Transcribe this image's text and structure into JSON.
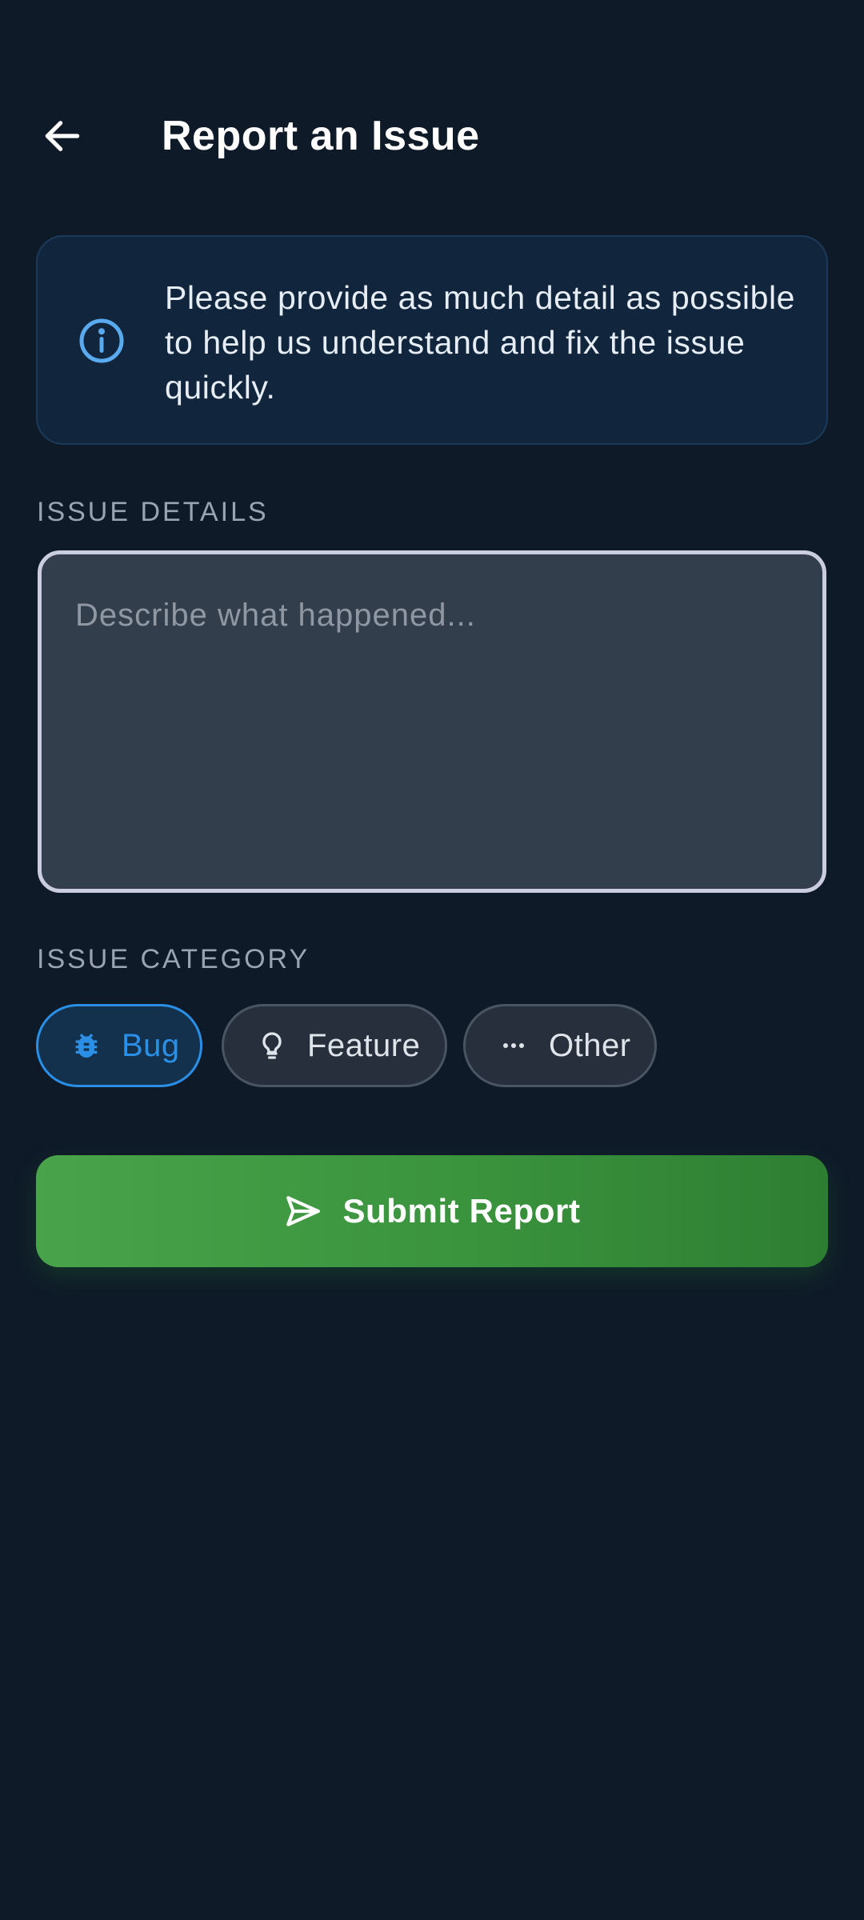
{
  "header": {
    "title": "Report an Issue",
    "back_icon": "arrow-left-icon"
  },
  "info_card": {
    "icon": "info-icon",
    "text": "Please provide as much detail as possible to help us understand and fix the issue quickly."
  },
  "issue_details": {
    "label": "ISSUE DETAILS",
    "value": "",
    "placeholder": "Describe what happened..."
  },
  "issue_category": {
    "label": "ISSUE CATEGORY",
    "selected": "Bug",
    "options": [
      {
        "label": "Bug",
        "icon": "bug-icon",
        "selected": true
      },
      {
        "label": "Feature",
        "icon": "lightbulb-icon",
        "selected": false
      },
      {
        "label": "Other",
        "icon": "more-horizontal-icon",
        "selected": false
      }
    ]
  },
  "submit": {
    "label": "Submit Report",
    "icon": "send-icon"
  },
  "colors": {
    "background": "#0f1a29",
    "info_card_bg": "#11263d",
    "accent_blue": "#2b8fe6",
    "submit_green": "#43a047",
    "input_bg": "#333e4d",
    "input_border": "#c9cddf"
  }
}
